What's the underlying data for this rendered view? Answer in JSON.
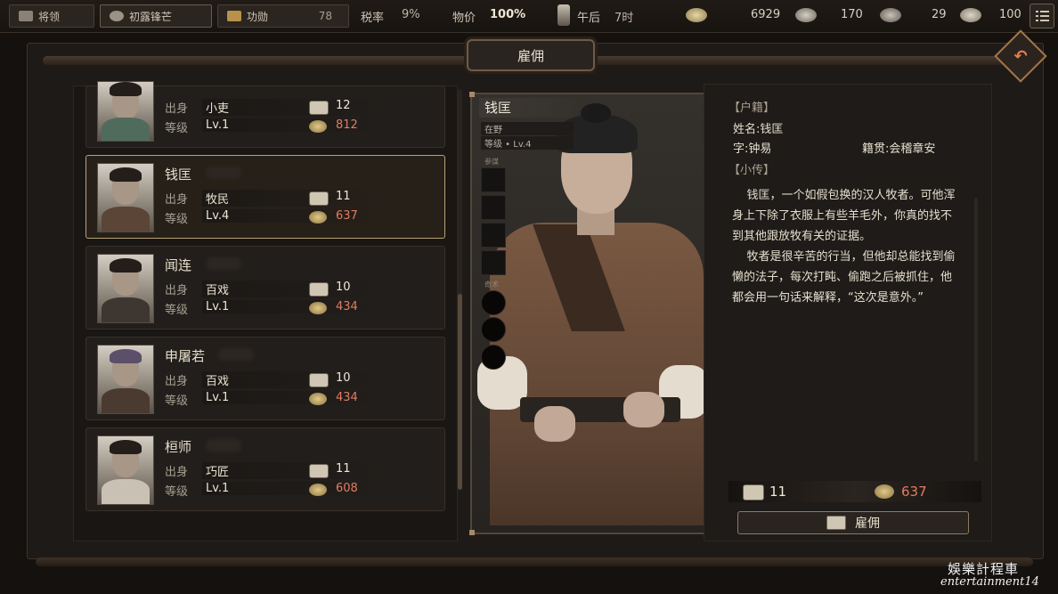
{
  "topbar": {
    "tab_general": "将领",
    "tab_first": "初露锋芒",
    "merit_label": "功勋",
    "merit_value": "78",
    "tax_label": "税率",
    "tax_value": "9%",
    "price_label": "物价",
    "price_value": "100%",
    "time_label": "午后",
    "time_value": "7时",
    "res_money": "6929",
    "res_food": "170",
    "res_iron": "29",
    "res_scroll": "100"
  },
  "window": {
    "title": "雇佣"
  },
  "candidates": [
    {
      "name": "",
      "origin_label": "出身",
      "origin": "小吏",
      "level_label": "等级",
      "level": "Lv.1",
      "scroll_cost": "12",
      "coin_cost": "812"
    },
    {
      "name": "钱匡",
      "origin_label": "出身",
      "origin": "牧民",
      "level_label": "等级",
      "level": "Lv.4",
      "scroll_cost": "11",
      "coin_cost": "637"
    },
    {
      "name": "闻连",
      "origin_label": "出身",
      "origin": "百戏",
      "level_label": "等级",
      "level": "Lv.1",
      "scroll_cost": "10",
      "coin_cost": "434"
    },
    {
      "name": "申屠若",
      "origin_label": "出身",
      "origin": "百戏",
      "level_label": "等级",
      "level": "Lv.1",
      "scroll_cost": "10",
      "coin_cost": "434"
    },
    {
      "name": "桓师",
      "origin_label": "出身",
      "origin": "巧匠",
      "level_label": "等级",
      "level": "Lv.1",
      "scroll_cost": "11",
      "coin_cost": "608"
    }
  ],
  "selected": {
    "name": "钱匡",
    "status": "在野",
    "level": "等级 • Lv.4",
    "slot_label_1": "参谋",
    "slot_label_2": "奇术",
    "registry_head": "【户籍】",
    "name_line": "姓名:钱匡",
    "courtesy_line": "字:钟易",
    "hometown_line": "籍贯:会稽章安",
    "bio_head": "【小传】",
    "bio": "    钱匡，一个如假包换的汉人牧者。可他浑身上下除了衣服上有些羊毛外，你真的找不到其他跟放牧有关的证据。\n    牧者是很辛苦的行当，但他却总能找到偷懒的法子，每次打盹、偷跑之后被抓住，他都会用一句话来解释，“这次是意外。”",
    "scroll_cost": "11",
    "coin_cost": "637",
    "hire_label": "雇佣"
  },
  "watermark": {
    "line1": "娛樂計程車",
    "line2": "entertainment14"
  },
  "colors": {
    "accent_red": "#e27c62",
    "gold_border": "#b8a273"
  },
  "icons": [
    "banner-icon",
    "brush-icon",
    "merit-icon",
    "hourglass-icon",
    "coin-icon",
    "grain-icon",
    "ore-icon",
    "scroll-icon",
    "menu-icon",
    "back-arrow-icon"
  ]
}
